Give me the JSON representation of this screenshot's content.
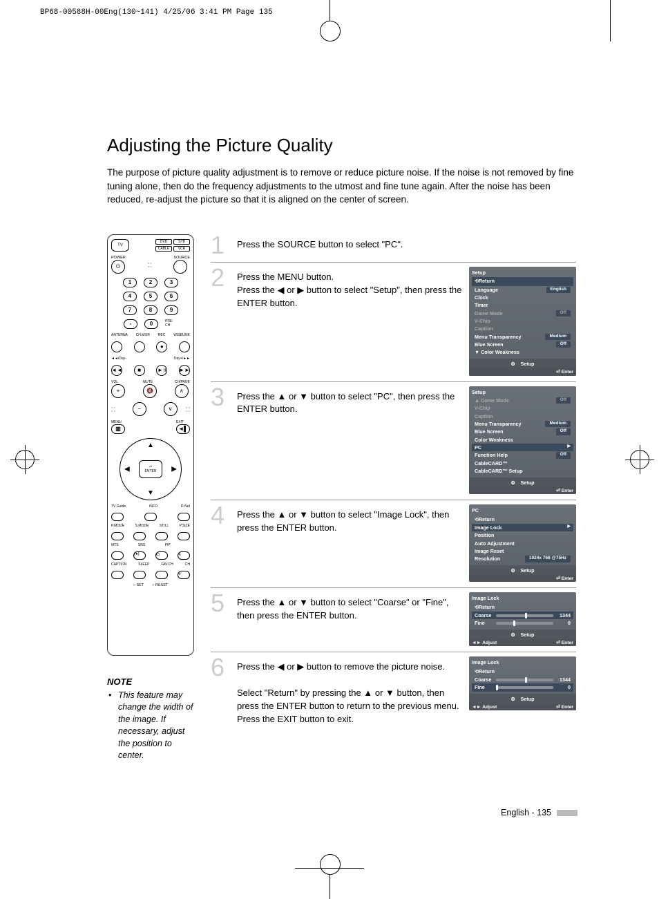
{
  "crop_header": "BP68-00588H-00Eng(130~141)  4/25/06  3:41 PM  Page 135",
  "title": "Adjusting the Picture Quality",
  "intro": "The purpose of picture quality adjustment is to remove or reduce picture noise. If the noise is not removed by fine tuning alone, then do the frequency adjustments to the utmost and fine tune again. After the noise has been reduced, re-adjust the picture so that it is aligned on the center of screen.",
  "remote": {
    "device_tv": "TV",
    "device_dvd": "DVD",
    "device_stb": "STB",
    "device_cable": "CABLE",
    "device_vcr": "VCR",
    "power": "POWER",
    "source": "SOURCE",
    "nums": [
      "1",
      "2",
      "3",
      "4",
      "5",
      "6",
      "7",
      "8",
      "9",
      "0"
    ],
    "dash": "-",
    "prech": "PRE-CH",
    "antenna": "ANTENNA",
    "chmgr": "CH.MGR",
    "rec": "REC",
    "wiselink": "WISELINK",
    "day_minus": "◄◄/Day-",
    "day_plus": "Day+/►►",
    "vol": "VOL",
    "chpage": "CH/PAGE",
    "mute": "MUTE",
    "menu": "MENU",
    "exit": "EXIT",
    "enter": "ENTER",
    "tvguide": "TV Guide",
    "info": "INFO",
    "dnet": "D-Net",
    "pmode": "P.MODE",
    "smode": "S.MODE",
    "still": "STILL",
    "psize": "P.SIZE",
    "mts": "MTS",
    "srs": "SRS",
    "pip": "PIP",
    "caption": "CAPTION",
    "sleep": "SLEEP",
    "favch": "FAV.CH",
    "ch": "CH",
    "set": "○ SET",
    "reset": "○ RESET"
  },
  "note_heading": "NOTE",
  "note_body": "This feature may change the width of the image. If necessary, adjust the position to center.",
  "steps": [
    {
      "n": "1",
      "text": "Press the SOURCE button to select \"PC\"."
    },
    {
      "n": "2",
      "text": "Press the MENU button.\nPress the ◀ or ▶ button to select \"Setup\", then press the ENTER button."
    },
    {
      "n": "3",
      "text": "Press the ▲ or ▼ button to select \"PC\", then press the ENTER button."
    },
    {
      "n": "4",
      "text": "Press the ▲ or ▼ button to select \"Image Lock\", then press the ENTER button."
    },
    {
      "n": "5",
      "text": "Press the ▲ or ▼ button to select \"Coarse\" or \"Fine\", then press the ENTER button."
    },
    {
      "n": "6",
      "text": "Press the ◀ or ▶ button to remove the picture noise.\n\nSelect \"Return\" by pressing the ▲ or ▼ button, then press the ENTER button to return to the previous menu. Press the EXIT button to exit."
    }
  ],
  "osd2": {
    "title": "Setup",
    "return": "Return",
    "items": [
      {
        "l": "Language",
        "v": "English"
      },
      {
        "l": "Clock",
        "v": ""
      },
      {
        "l": "Timer",
        "v": ""
      },
      {
        "l": "Game Mode",
        "v": "Off",
        "dim": true
      },
      {
        "l": "V-Chip",
        "v": "",
        "dim": true
      },
      {
        "l": "Caption",
        "v": "",
        "dim": true
      },
      {
        "l": "Menu Transparency",
        "v": "Medium"
      },
      {
        "l": "Blue Screen",
        "v": "Off"
      },
      {
        "l": "Color Weakness",
        "v": "",
        "down": true
      }
    ],
    "footer": "Setup",
    "enter": "Enter"
  },
  "osd3": {
    "title": "Setup",
    "items": [
      {
        "l": "Game Mode",
        "v": "Off",
        "dim": true,
        "up": true
      },
      {
        "l": "V-Chip",
        "v": "",
        "dim": true
      },
      {
        "l": "Caption",
        "v": "",
        "dim": true
      },
      {
        "l": "Menu Transparency",
        "v": "Medium"
      },
      {
        "l": "Blue Screen",
        "v": "Off"
      },
      {
        "l": "Color Weakness",
        "v": ""
      },
      {
        "l": "PC",
        "v": "",
        "hl": true,
        "arrow": true
      },
      {
        "l": "Function Help",
        "v": "Off"
      },
      {
        "l": "CableCARD™",
        "v": ""
      },
      {
        "l": "CableCARD™ Setup",
        "v": ""
      }
    ],
    "footer": "Setup",
    "enter": "Enter"
  },
  "osd4": {
    "title": "PC",
    "return": "Return",
    "items": [
      {
        "l": "Image Lock",
        "v": "",
        "hl": true,
        "arrow": true
      },
      {
        "l": "Position",
        "v": ""
      },
      {
        "l": "Auto Adjustment",
        "v": ""
      },
      {
        "l": "Image Reset",
        "v": ""
      },
      {
        "l": "Resolution",
        "v": "1024x 768 @75Hz"
      }
    ],
    "footer": "Setup",
    "enter": "Enter"
  },
  "osd5": {
    "title": "Image Lock",
    "return": "Return",
    "sliders": [
      {
        "l": "Coarse",
        "v": "1344",
        "p": "p50",
        "hl": true
      },
      {
        "l": "Fine",
        "v": "0",
        "p": "p30"
      }
    ],
    "footer": "Setup",
    "adjust": "Adjust",
    "enter": "Enter"
  },
  "osd6": {
    "title": "Image Lock",
    "return": "Return",
    "sliders": [
      {
        "l": "Coarse",
        "v": "1344",
        "p": "p50"
      },
      {
        "l": "Fine",
        "v": "0",
        "p": "p0",
        "hl": true
      }
    ],
    "footer": "Setup",
    "adjust": "Adjust",
    "enter": "Enter"
  },
  "footer_text": "English - 135"
}
